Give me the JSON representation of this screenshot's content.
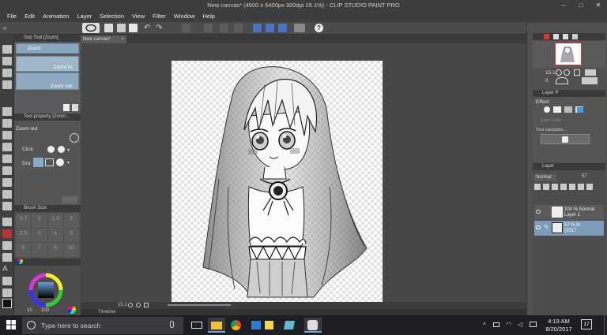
{
  "window": {
    "title": "New canvas* (4500 x 5400px 300dpi 15.1%) - CLIP STUDIO PAINT PRO",
    "minimize": "–",
    "maximize": "□",
    "close": "✕"
  },
  "menu": [
    "File",
    "Edit",
    "Animation",
    "Layer",
    "Selection",
    "View",
    "Filter",
    "Window",
    "Help"
  ],
  "subtool": {
    "tab_label": "Sub Tool [Zoom]",
    "items": [
      "Zoom",
      "Zoom in",
      "Zoom out"
    ]
  },
  "tool_property": {
    "header": "Tool property [Zoom...",
    "title": "Zoom out",
    "click_label": "Click",
    "drag_label": "Dra"
  },
  "brush_size": {
    "header": "Brush Size",
    "sizes": [
      "0.7",
      "1",
      "1.5",
      "2",
      "2.5",
      "3",
      "4",
      "5",
      "6",
      "7",
      "8",
      "10"
    ]
  },
  "color": {
    "readouts": [
      "10",
      "100"
    ]
  },
  "canvas": {
    "tab_label": "New canvas*",
    "zoom": "15.1",
    "timeline_label": "Timeline"
  },
  "navigator": {
    "zoom": "15.1",
    "angle": "0"
  },
  "layer_property": {
    "header": "Layer P",
    "effect_label": "Effect",
    "expression_label": "Tool navigatio...",
    "color_label": "Expr Color"
  },
  "layer": {
    "header": "Layer",
    "blend_mode": "Normal",
    "opacity": "57",
    "rows": [
      {
        "line1": "100 % Normal",
        "line2": "Layer 1"
      },
      {
        "line1": "57 % N",
        "line2": "(2017"
      }
    ]
  },
  "taskbar": {
    "search_placeholder": "Type here to search",
    "time": "4:19 AM",
    "date": "8/20/2017",
    "notif_count": "17"
  }
}
